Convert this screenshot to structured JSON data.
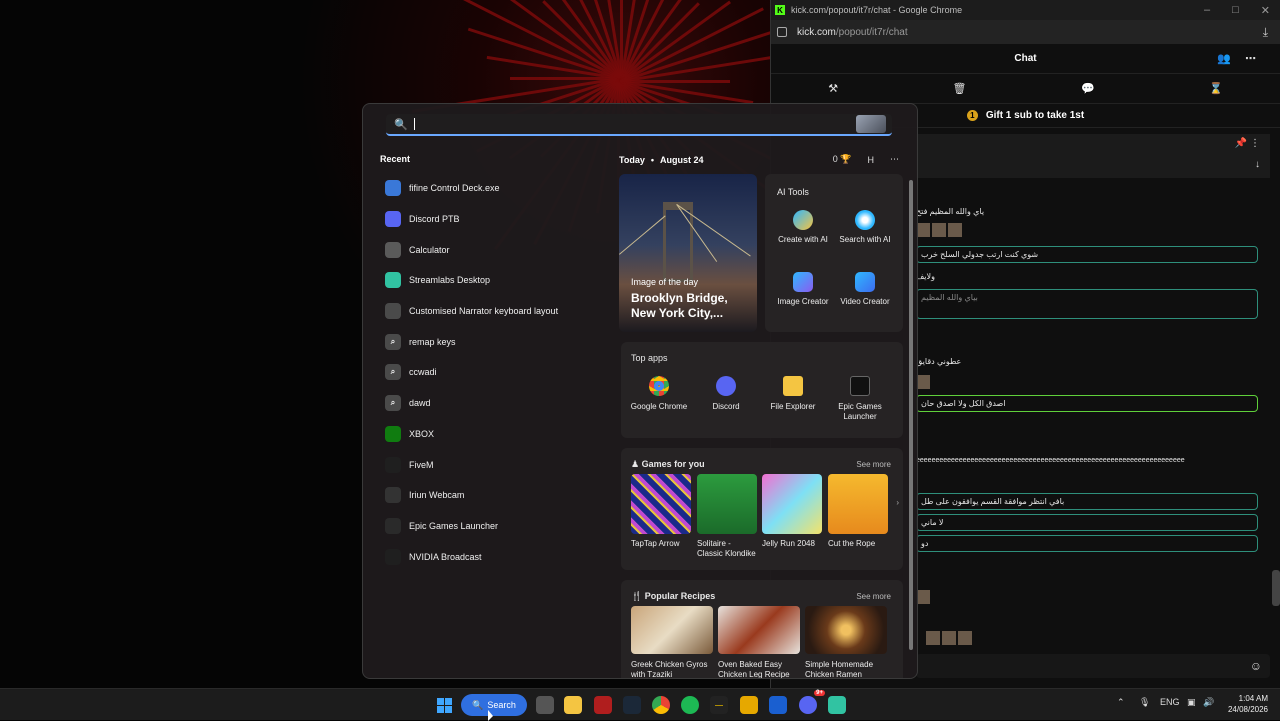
{
  "chrome_window": {
    "title": "kick.com/popout/it7r/chat - Google Chrome",
    "url_host": "kick.com",
    "url_path": "/popout/it7r/chat",
    "chat_header": "Chat",
    "gift_banner": "Gift 1 sub to take 1st",
    "messages": [
      {
        "text": "ياي والله المظيم فتح",
        "boxed": false
      },
      {
        "text": "شوي كنت ارتب جدولي السلح خرب",
        "boxed": true
      },
      {
        "text": "ولايف",
        "boxed": false
      },
      {
        "text": "بياي والله المظيم",
        "boxed": true
      },
      {
        "text": "عطوني دقايق",
        "boxed": false
      },
      {
        "text": "اصدق الكل ولا اصدق حان",
        "boxed": true
      },
      {
        "text": "eeeeeeeeeeeeeeeeeeeeeeeeeeeeeeeeeeeeeeeeeeeeeeeeeeeeeeeeeeeeeeeeeeeee",
        "boxed": false
      },
      {
        "text": "بافي انتظر موافقة القسم يوافقون على طل",
        "boxed": true
      },
      {
        "text": "لا ماني",
        "boxed": true
      },
      {
        "text": "دو",
        "boxed": true
      }
    ]
  },
  "start_menu": {
    "recent_title": "Recent",
    "recent": [
      {
        "label": "fifine Control Deck.exe",
        "icon": "fifine-icon",
        "color": "#3a78d8"
      },
      {
        "label": "Discord PTB",
        "icon": "discord-icon",
        "color": "#5865f2"
      },
      {
        "label": "Calculator",
        "icon": "calculator-icon",
        "color": "#5a5a5a"
      },
      {
        "label": "Streamlabs Desktop",
        "icon": "streamlabs-icon",
        "color": "#31c3a2"
      },
      {
        "label": "Customised Narrator keyboard layout",
        "icon": "narrator-icon",
        "color": "#4a4a4a"
      },
      {
        "label": "remap keys",
        "icon": "search-icon",
        "color": "#4a4a4a"
      },
      {
        "label": "ccwadi",
        "icon": "search-icon",
        "color": "#4a4a4a"
      },
      {
        "label": "dawd",
        "icon": "search-icon",
        "color": "#4a4a4a"
      },
      {
        "label": "XBOX",
        "icon": "xbox-icon",
        "color": "#107c10"
      },
      {
        "label": "FiveM",
        "icon": "fivem-icon",
        "color": "#1f1f1f"
      },
      {
        "label": "Iriun Webcam",
        "icon": "iriun-icon",
        "color": "#333333"
      },
      {
        "label": "Epic Games Launcher",
        "icon": "epic-icon",
        "color": "#2a2a2a"
      },
      {
        "label": "NVIDIA Broadcast",
        "icon": "nvidia-icon",
        "color": "#1f1f1f"
      }
    ],
    "today_label": "Today",
    "date_label": "August 24",
    "points": "0",
    "profile_initial": "H",
    "image_of_day_label": "Image of the day",
    "image_of_day_title": "Brooklyn Bridge, New York City,...",
    "ai_tools": {
      "title": "AI Tools",
      "items": [
        "Create with AI",
        "Search with AI",
        "Image Creator",
        "Video Creator"
      ]
    },
    "top_apps": {
      "title": "Top apps",
      "items": [
        "Google Chrome",
        "Discord",
        "File Explorer",
        "Epic Games Launcher"
      ]
    },
    "games": {
      "title": "Games for you",
      "see_more": "See more",
      "items": [
        "TapTap Arrow",
        "Solitaire - Classic Klondike",
        "Jelly Run 2048",
        "Cut the Rope"
      ]
    },
    "recipes": {
      "title": "Popular Recipes",
      "see_more": "See more",
      "items": [
        "Greek Chicken Gyros with Tzaziki",
        "Oven Baked Easy Chicken Leg Recipe",
        "Simple Homemade Chicken Ramen"
      ]
    }
  },
  "taskbar": {
    "search_label": "Search",
    "language": "ENG",
    "time": "1:04 AM",
    "date": "24/08/2026",
    "discord_badge": "9+"
  }
}
